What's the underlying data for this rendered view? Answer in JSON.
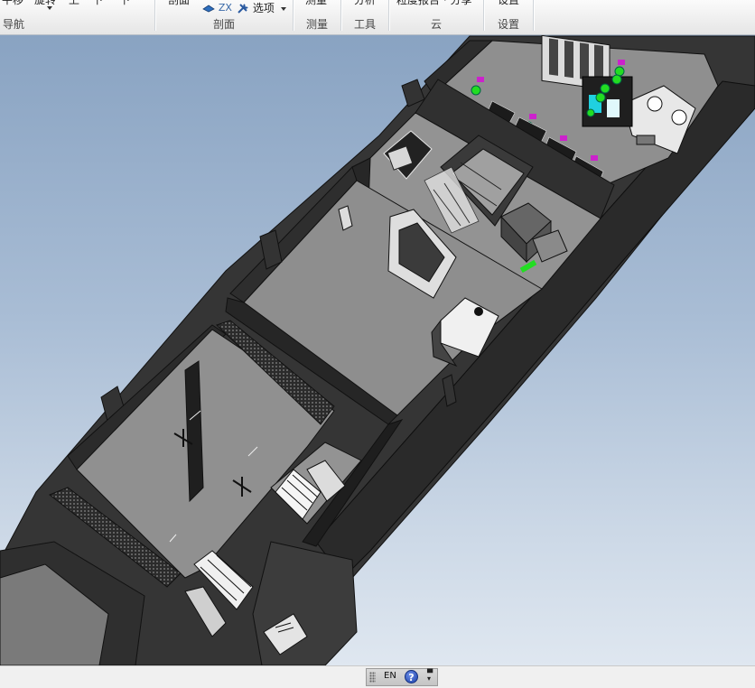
{
  "ribbon": {
    "groups": [
      {
        "id": "nav",
        "label": "导航",
        "buttons": [
          "平移",
          "旋转",
          "上",
          "下",
          "下"
        ]
      },
      {
        "id": "section",
        "label": "剖面",
        "buttons": [
          "剖面",
          "ZX",
          "选项"
        ]
      },
      {
        "id": "measure",
        "label": "测量",
        "buttons": [
          "测量"
        ]
      },
      {
        "id": "tools",
        "label": "工具",
        "buttons": [
          "分析"
        ]
      },
      {
        "id": "cloud",
        "label": "云",
        "buttons": [
          "粒度报告 · 分享"
        ]
      },
      {
        "id": "settings",
        "label": "设置",
        "buttons": [
          "设置"
        ]
      }
    ]
  },
  "viewport": {
    "description_colors": {
      "sky_top": "#89a3c2",
      "sky_bottom": "#dfe7f0",
      "wall": "#3a3a3a",
      "floor": "#8c8c8c",
      "accent_green": "#22dd22",
      "accent_magenta": "#cc22cc",
      "accent_cyan": "#20d0e0"
    }
  },
  "statusbar": {
    "language": "EN",
    "help": "?"
  }
}
